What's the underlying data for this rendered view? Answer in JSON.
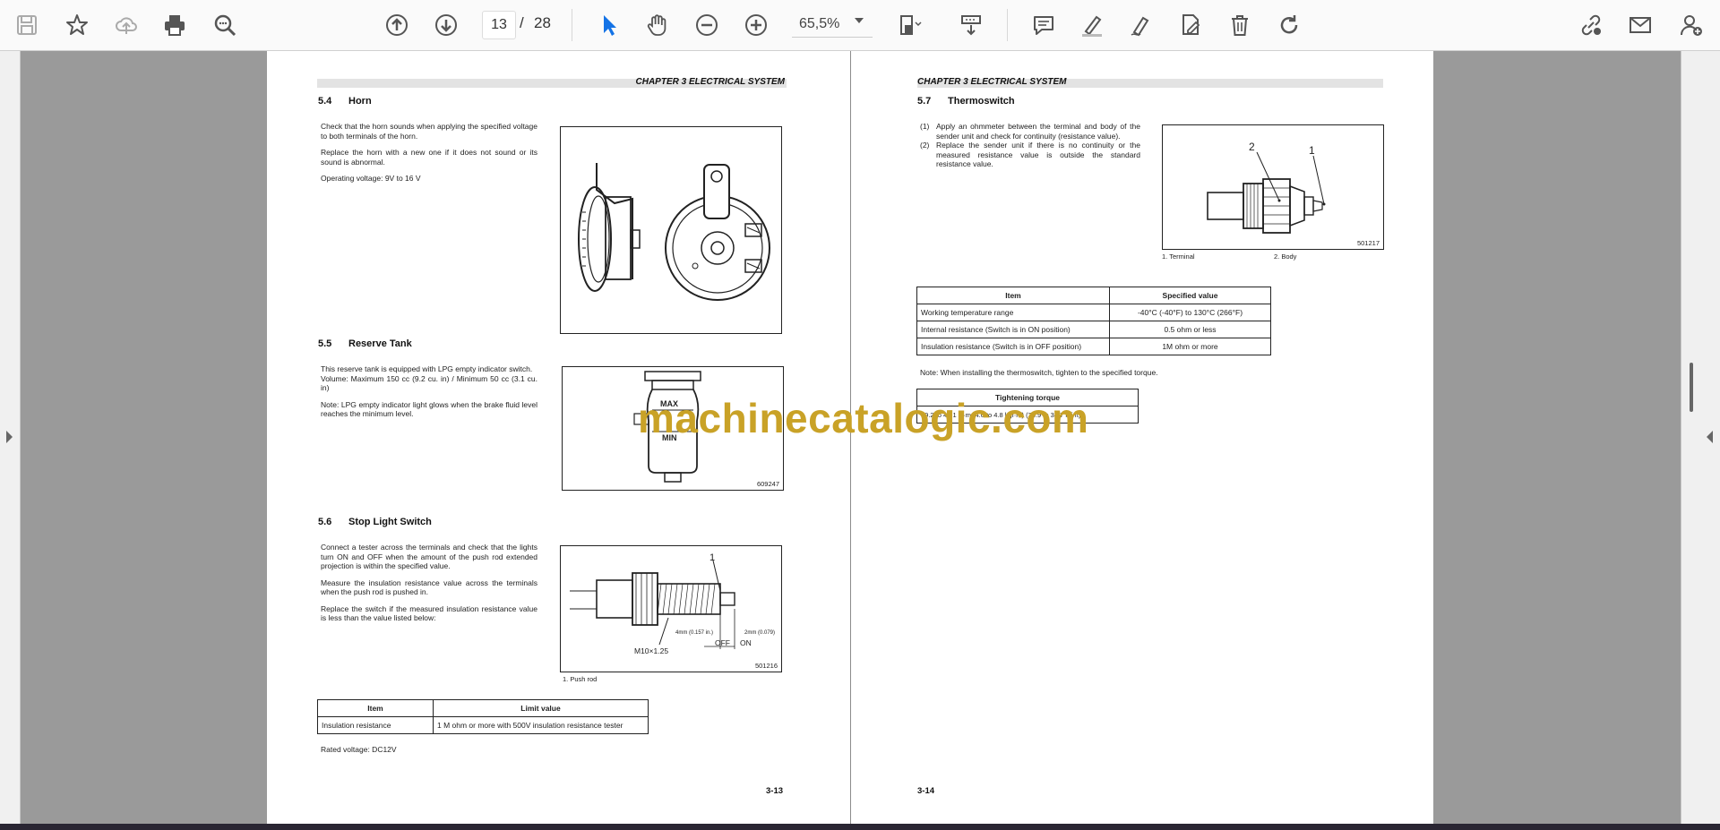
{
  "toolbar": {
    "current_page": "13",
    "page_separator": "/",
    "total_pages": "28",
    "zoom": "65,5%"
  },
  "page_left": {
    "chapter": "CHAPTER 3 ELECTRICAL SYSTEM",
    "s54": {
      "num": "5.4",
      "title": "Horn",
      "p1": "Check that the horn sounds when applying the specified voltage to both terminals of the horn.",
      "p2": "Replace the horn with a new one if it does not sound or its sound is abnormal.",
      "p3": "Operating voltage: 9V to 16 V"
    },
    "s55": {
      "num": "5.5",
      "title": "Reserve Tank",
      "p1": "This reserve tank is equipped with LPG empty indicator switch.",
      "p2": "Volume: Maximum 150 cc (9.2 cu. in) / Minimum 50 cc (3.1 cu. in)",
      "p3": "Note: LPG empty indicator light glows when the brake fluid level reaches the minimum level.",
      "fig_max": "MAX",
      "fig_min": "MIN",
      "fig_num": "609247"
    },
    "s56": {
      "num": "5.6",
      "title": "Stop Light Switch",
      "p1": "Connect a tester across the terminals and check that the lights turn ON and OFF when the amount of the push rod extended projection is within the specified value.",
      "p2": "Measure the insulation resistance value across the terminals when the push rod is pushed in.",
      "p3": "Replace the switch if the measured insulation resistance value is less than the value listed below:",
      "fig_callout": "1",
      "fig_dim1": "4mm (0.157 in.)",
      "fig_dim2": "2mm (0.079)",
      "fig_thread": "M10×1.25",
      "fig_off": "OFF",
      "fig_on": "ON",
      "fig_num": "501216",
      "caption": "1. Push rod"
    },
    "table": {
      "h1": "Item",
      "h2": "Limit value",
      "c1": "Insulation resistance",
      "c2": "1 M ohm or more with 500V insulation resistance tester"
    },
    "rated": "Rated voltage: DC12V",
    "footer": "3-13"
  },
  "page_right": {
    "chapter": "CHAPTER 3 ELECTRICAL SYSTEM",
    "s57": {
      "num": "5.7",
      "title": "Thermoswitch",
      "i1n": "(1)",
      "i1": "Apply an ohmmeter between the terminal and body of the sender unit and check for continuity (resistance value).",
      "i2n": "(2)",
      "i2": "Replace the sender unit if there is no continuity or the measured resistance value is outside the standard resistance value.",
      "fig_c1": "1",
      "fig_c2": "2",
      "fig_num": "501217",
      "cap1": "1. Terminal",
      "cap2": "2. Body"
    },
    "table": {
      "h1": "Item",
      "h2": "Specified value",
      "rows": [
        [
          "Working temperature range",
          "-40°C (-40°F) to 130°C (266°F)"
        ],
        [
          "Internal resistance (Switch is in ON position)",
          "0.5 ohm or less"
        ],
        [
          "Insulation resistance (Switch is in OFF position)",
          "1M ohm or more"
        ]
      ]
    },
    "note": "Note: When installing the thermoswitch, tighten to the specified torque.",
    "torque": {
      "h": "Tightening torque",
      "v": "39.2 to 47.1 N·m (4.0 to 4.8 kgf·m) (28.9 to 34.7 lbf·ft)"
    },
    "footer": "3-14"
  },
  "watermark": "machinecatalogic.com"
}
